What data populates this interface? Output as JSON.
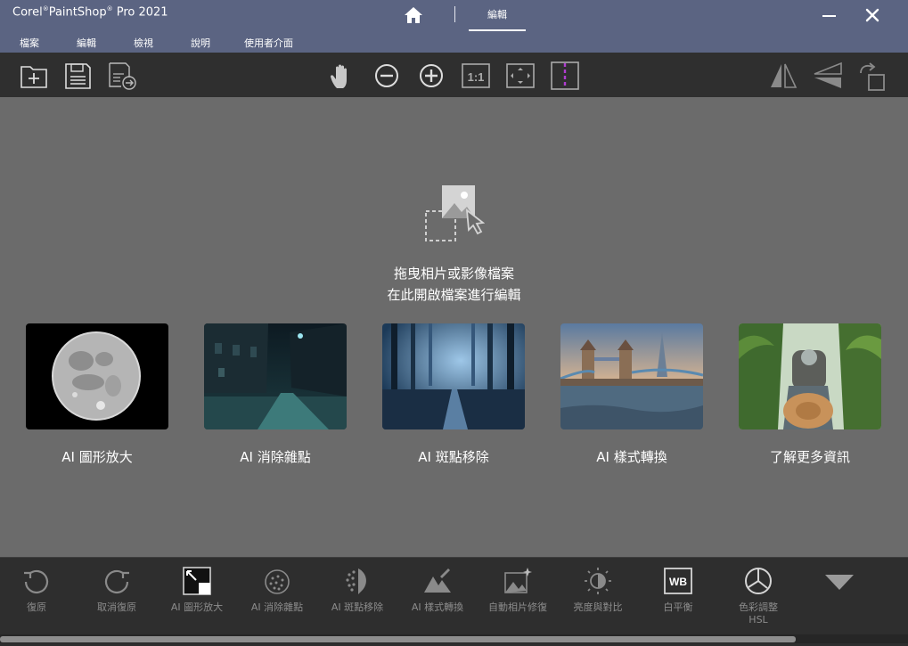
{
  "titlebar": {
    "brand": "Corel",
    "product": "PaintShop",
    "pro": "Pro 2021",
    "active_tab": "編輯",
    "bg_color": "#5b6482"
  },
  "menu": [
    "檔案",
    "編輯",
    "檢視",
    "說明",
    "使用者介面"
  ],
  "toolbar_icons": [
    "new-file-icon",
    "save-icon",
    "save-as-icon",
    "pan-hand-icon",
    "zoom-out-icon",
    "zoom-in-icon",
    "actual-size-icon",
    "fit-to-window-icon",
    "before-after-split-icon",
    "flip-horizontal-icon",
    "flip-vertical-icon",
    "rotate-icon"
  ],
  "actual_size_label": "1:1",
  "drop_zone": {
    "line1": "拖曳相片或影像檔案",
    "line2": "在此開啟檔案進行編輯"
  },
  "cards": [
    {
      "label": "AI 圖形放大",
      "image": "full-moon-photo"
    },
    {
      "label": "AI 消除雜點",
      "image": "night-street-photo"
    },
    {
      "label": "AI 斑點移除",
      "image": "foggy-forest-photo"
    },
    {
      "label": "AI 樣式轉換",
      "image": "tower-bridge-photo"
    },
    {
      "label": "了解更多資訊",
      "image": "traveler-jungle-photo"
    }
  ],
  "quick_tools": [
    {
      "label": "復原",
      "icon": "undo-icon"
    },
    {
      "label": "取消復原",
      "icon": "redo-icon"
    },
    {
      "label": "AI 圖形放大",
      "icon": "ai-upscale-icon"
    },
    {
      "label": "AI 消除雜點",
      "icon": "ai-denoise-icon"
    },
    {
      "label": "AI 斑點移除",
      "icon": "ai-artifact-removal-icon"
    },
    {
      "label": "AI 樣式轉換",
      "icon": "ai-style-transfer-icon"
    },
    {
      "label": "自動相片修復",
      "icon": "auto-fix-icon"
    },
    {
      "label": "亮度與對比",
      "icon": "brightness-contrast-icon"
    },
    {
      "label": "白平衡",
      "icon": "white-balance-icon"
    },
    {
      "label": "色彩調整 HSL",
      "icon": "hsl-icon"
    }
  ],
  "wb_badge": "WB",
  "scrollbar_position": 0.88
}
